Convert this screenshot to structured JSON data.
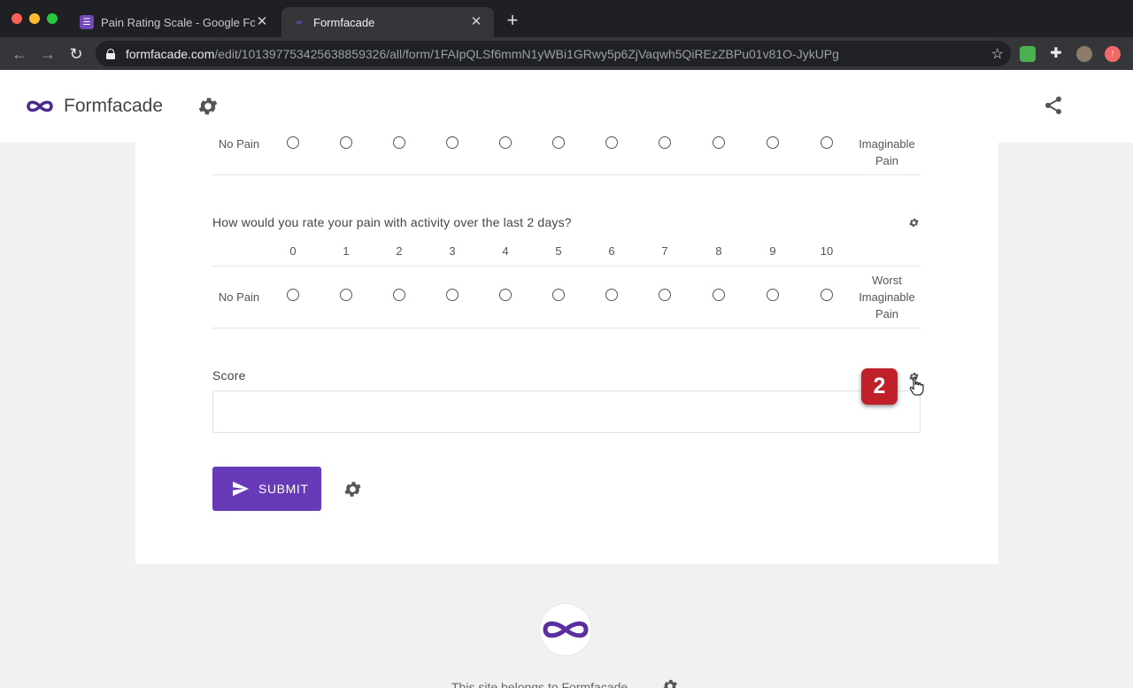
{
  "browser": {
    "tabs": [
      {
        "title": "Pain Rating Scale - Google Forms"
      },
      {
        "title": "Formfacade"
      }
    ],
    "url_host": "formfacade.com",
    "url_path": "/edit/101397753425638859326/all/form/1FAIpQLSf6mmN1yWBi1GRwy5p6ZjVaqwh5QiREzZBPu01v81O-JykUPg"
  },
  "header": {
    "app_title": "Formfacade"
  },
  "form": {
    "prev_row": {
      "left_label": "No Pain",
      "right_label_line2": "Imaginable",
      "right_label_line3": "Pain"
    },
    "question2": {
      "text": "How would you rate your pain with activity over the last 2 days?",
      "scale": [
        "0",
        "1",
        "2",
        "3",
        "4",
        "5",
        "6",
        "7",
        "8",
        "9",
        "10"
      ],
      "left_label": "No Pain",
      "right_label": [
        "Worst",
        "Imaginable",
        "Pain"
      ]
    },
    "score": {
      "label": "Score",
      "value": ""
    },
    "submit_label": "SUBMIT"
  },
  "annotation": {
    "step_number": "2"
  },
  "footer": {
    "text": "This site belongs to Formfacade"
  },
  "colors": {
    "accent": "#673ab7",
    "badge": "#c0202a"
  }
}
